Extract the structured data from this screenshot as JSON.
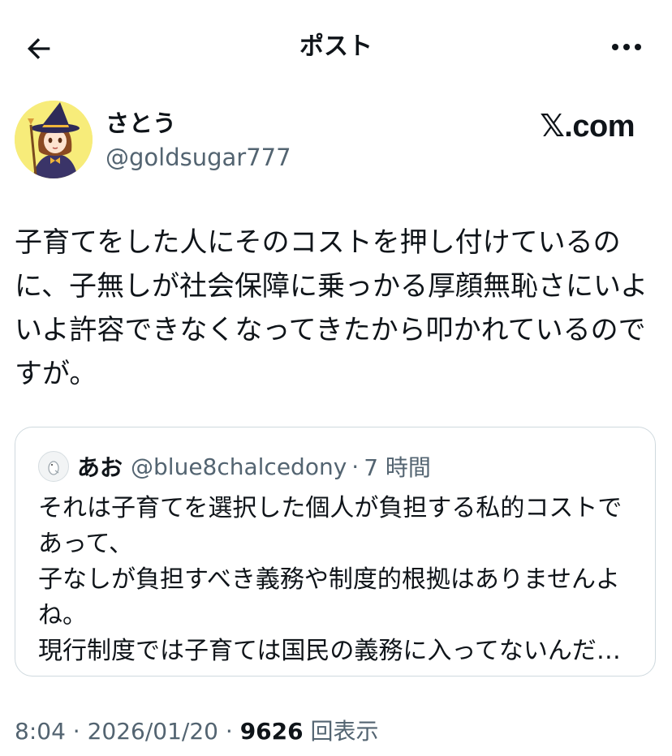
{
  "header": {
    "title": "ポスト",
    "back_icon": "arrow-left-icon",
    "more_icon": "more-horizontal-icon"
  },
  "author": {
    "display_name": "さとう",
    "handle": "@goldsugar777",
    "source_logo": "𝕏.com"
  },
  "post": {
    "lines": [
      "子育てをした人にそのコストを押し付けているの",
      "に、子無しが社会保障に乗っかる厚顔無恥さにいよ",
      "いよ許容できなくなってきたから叩かれているので",
      "すが。"
    ]
  },
  "quote": {
    "display_name": "あお",
    "handle": "@blue8chalcedony",
    "separator": "·",
    "time": "7 時間",
    "lines": [
      "それは子育てを選択した個人が負担する私的コストで",
      "あって、",
      "子なしが負担すべき義務や制度的根拠はありませんよ",
      "ね。",
      "現行制度では子育ては国民の義務に入ってないんだ…"
    ]
  },
  "meta": {
    "time": "8:04",
    "sep1": " · ",
    "date": "2026/01/20",
    "sep2": " · ",
    "views_count": "9626",
    "views_label": " 回表示"
  },
  "colors": {
    "text": "#0f1419",
    "secondary": "#536471",
    "border": "#cfd9de",
    "avatar_bg": "#f7ec7a"
  }
}
